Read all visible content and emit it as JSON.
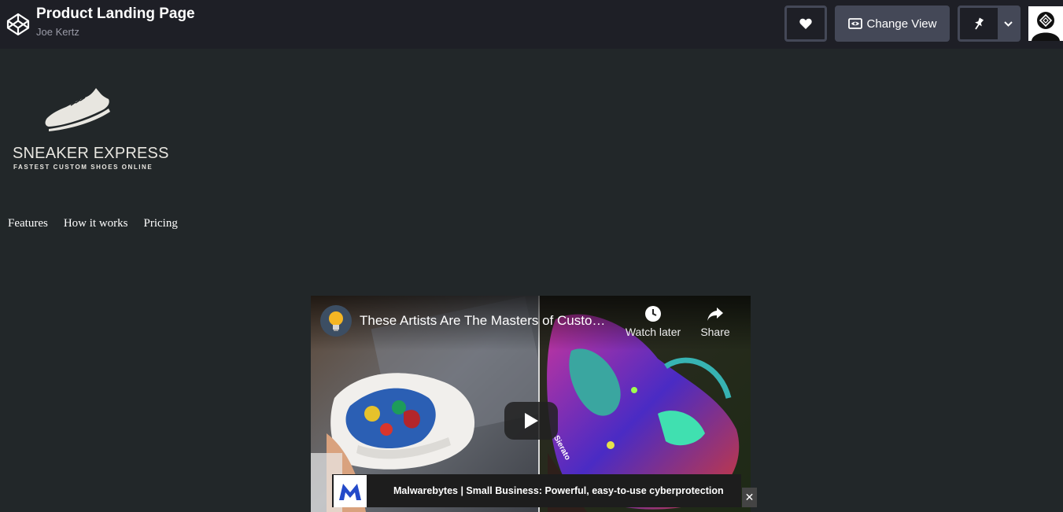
{
  "header": {
    "title": "Product Landing Page",
    "author": "Joe Kertz",
    "change_view_label": "Change View",
    "icons": {
      "logo": "codepen-logo-icon",
      "heart": "heart-icon",
      "view": "eye-icon",
      "pin": "pin-icon",
      "dropdown": "chevron-down-icon"
    }
  },
  "page": {
    "brand": {
      "name": "SNEAKER EXPRESS",
      "tagline": "FASTEST CUSTOM SHOES ONLINE"
    },
    "nav": [
      {
        "label": "Features"
      },
      {
        "label": "How it works"
      },
      {
        "label": "Pricing"
      }
    ],
    "video": {
      "title": "These Artists Are The Masters of Custo…",
      "watch_later_label": "Watch later",
      "share_label": "Share",
      "shoe_tag": "Sierato"
    },
    "ad": {
      "text": "Malwarebytes | Small Business: Powerful, easy-to-use cyberprotection",
      "close_label": "✕"
    }
  },
  "colors": {
    "topbar": "#1e1f26",
    "page_bg": "#222729",
    "button": "#444857"
  }
}
